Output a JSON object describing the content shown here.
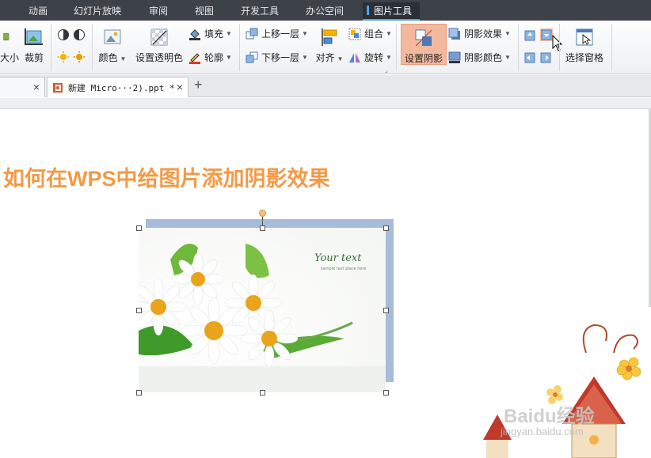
{
  "menubar": {
    "items": [
      "动画",
      "幻灯片放映",
      "审阅",
      "视图",
      "开发工具",
      "办公空间"
    ],
    "active": "图片工具"
  },
  "ribbon": {
    "size_label": "大小",
    "crop_label": "裁剪",
    "color_label": "颜色",
    "transparent_label": "设置透明色",
    "fill_label": "填充",
    "outline_label": "轮廓",
    "bring_forward_label": "上移一层",
    "send_backward_label": "下移一层",
    "align_label": "对齐",
    "group_label": "组合",
    "rotate_label": "旋转",
    "set_shadow_label": "设置阴影",
    "shadow_effect_label": "阴影效果",
    "shadow_color_label": "阴影颜色",
    "selection_pane_label": "选择窗格"
  },
  "tabs": {
    "doc_name": "新建 Micro···2).ppt *",
    "close_glyph": "×",
    "add_glyph": "+"
  },
  "slide": {
    "title": "如何在WPS中给图片添加阴影效果",
    "photo_text1": "Your text",
    "photo_text2": "sample text place here"
  },
  "watermark": {
    "logo": "Baidu经验",
    "url": "jingyan.baidu.com"
  },
  "colors": {
    "title": "#f29a45",
    "shadow": "#a7bcd8",
    "highlight": "#f3b99e",
    "menubar": "#3d4148"
  }
}
